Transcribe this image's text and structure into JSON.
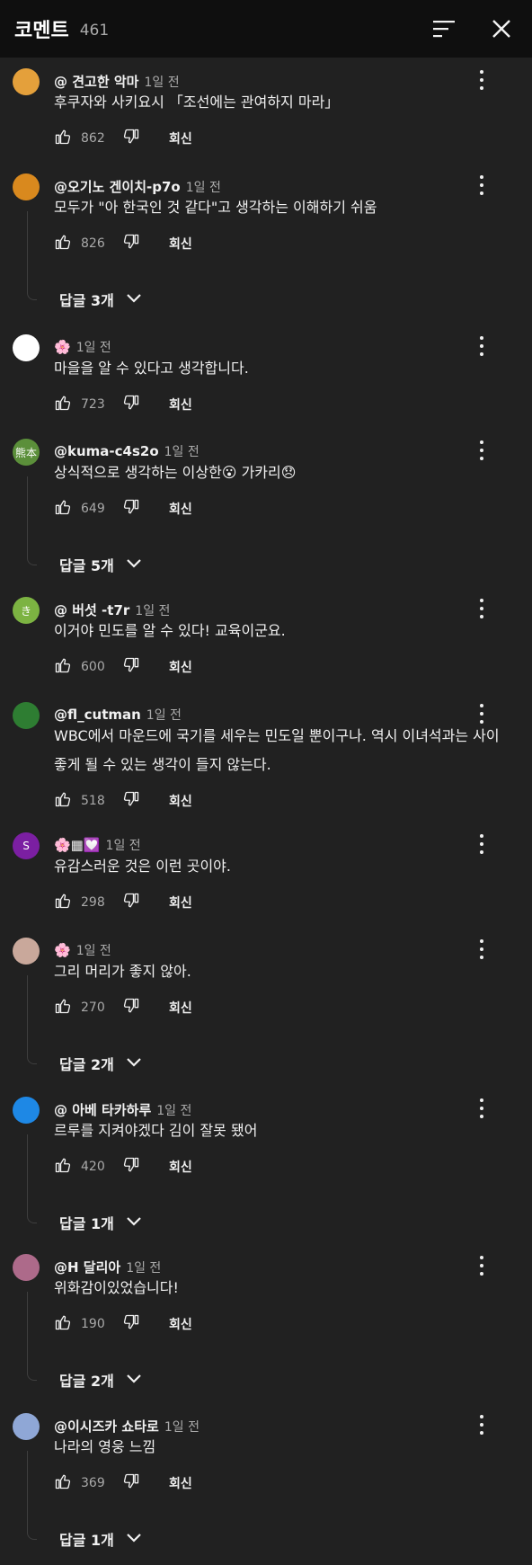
{
  "header": {
    "title": "코멘트",
    "count": "461"
  },
  "comments": [
    {
      "author": "@ 견고한 악마",
      "time": "1일 전",
      "text": "후쿠자와 사키요시 「조선에는 관여하지 마라」",
      "likes": "862",
      "reply": "회신",
      "replies": "",
      "avatar_color": "#e4a03b",
      "avatar_text": ""
    },
    {
      "author": "@오기노 겐이치-p7o",
      "time": "1일 전",
      "text": "모두가 \"아 한국인 것 같다\"고 생각하는 이해하기 쉬움",
      "likes": "826",
      "reply": "회신",
      "replies": "답글 3개",
      "avatar_color": "#d9891e",
      "avatar_text": ""
    },
    {
      "author": "🌸",
      "time": "1일 전",
      "text": "마을을 알 수 있다고 생각합니다.",
      "likes": "723",
      "reply": "회신",
      "replies": "",
      "avatar_color": "#ffffff",
      "avatar_text": ""
    },
    {
      "author": "@kuma-c4s2o",
      "time": "1일 전",
      "text": "상식적으로 생각하는 이상한😮 가카리😞",
      "likes": "649",
      "reply": "회신",
      "replies": "답글 5개",
      "avatar_color": "#5b8f3a",
      "avatar_text": "熊本"
    },
    {
      "author": "@ 버섯 -t7r",
      "time": "1일 전",
      "text": "이거야 민도를 알 수 있다! 교육이군요.",
      "likes": "600",
      "reply": "회신",
      "replies": "",
      "avatar_color": "#7cb342",
      "avatar_text": "き"
    },
    {
      "author": "@fl_cutman",
      "time": "1일 전",
      "text": "WBC에서 마운드에 국기를 세우는 민도일 뿐이구나. 역시 이녀석과는 사이좋게 될 수 있는 생각이 들지 않는다.",
      "likes": "518",
      "reply": "회신",
      "replies": "",
      "avatar_color": "#2e7d32",
      "avatar_text": ""
    },
    {
      "author": "🌸▦💟",
      "time": "1일 전",
      "text": "유감스러운 것은 이런 곳이야.",
      "likes": "298",
      "reply": "회신",
      "replies": "",
      "avatar_color": "#7b1fa2",
      "avatar_text": "S"
    },
    {
      "author": "🌸",
      "time": "1일 전",
      "text": "그리 머리가 좋지 않아.",
      "likes": "270",
      "reply": "회신",
      "replies": "답글 2개",
      "avatar_color": "#c9a89b",
      "avatar_text": ""
    },
    {
      "author": "@ 아베 타카하루",
      "time": "1일 전",
      "text": "르루를 지켜야겠다 김이 잘못 됐어",
      "likes": "420",
      "reply": "회신",
      "replies": "답글 1개",
      "avatar_color": "#1e88e5",
      "avatar_text": ""
    },
    {
      "author": "@H 달리아",
      "time": "1일 전",
      "text": "위화감이있었습니다!",
      "likes": "190",
      "reply": "회신",
      "replies": "답글 2개",
      "avatar_color": "#ad6a8a",
      "avatar_text": ""
    },
    {
      "author": "@이시즈카 쇼타로",
      "time": "1일 전",
      "text": "나라의 영웅 느낌",
      "likes": "369",
      "reply": "회신",
      "replies": "답글 1개",
      "avatar_color": "#8fa7d6",
      "avatar_text": ""
    }
  ]
}
